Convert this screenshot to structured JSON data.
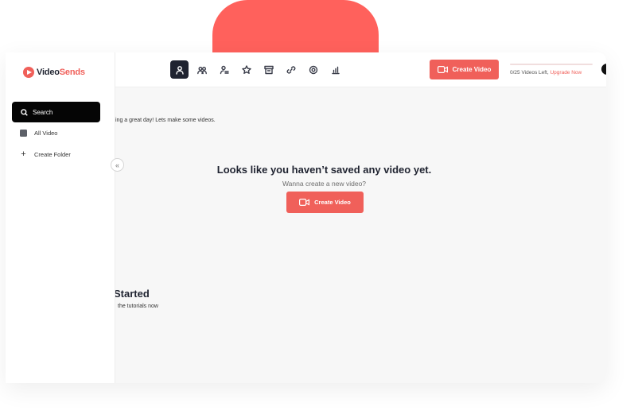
{
  "app": {
    "logo_part1": "Video",
    "logo_part2": "Sends"
  },
  "sidebar": {
    "search_label": "Search",
    "items": [
      {
        "label": "All Video",
        "icon": "folder-square-icon"
      },
      {
        "label": "Create Folder",
        "icon": "plus-icon"
      }
    ],
    "collapse_icon": "double-chevron-left-icon"
  },
  "topbar": {
    "nav_icons": [
      "user-icon",
      "users-icon",
      "user-list-icon",
      "star-icon",
      "archive-icon",
      "link-icon",
      "settings-icon",
      "analytics-icon"
    ],
    "active_nav": "user-icon",
    "create_button_label": "Create Video",
    "quota_text": "0/25 Videos Left,",
    "upgrade_link": "Upgrade Now",
    "quota_progress": 0
  },
  "main": {
    "greeting": "ing a great day! Lets make some videos.",
    "empty_title": "Looks like you haven’t saved any video yet.",
    "empty_subtitle": "Wanna create a new video?",
    "create_button_label": "Create Video",
    "getting_started_title": "Started",
    "getting_started_sub": "the tutorials now"
  },
  "colors": {
    "accent": "#f0605a",
    "dark": "#1f2330",
    "background": "#f7f7f7"
  }
}
